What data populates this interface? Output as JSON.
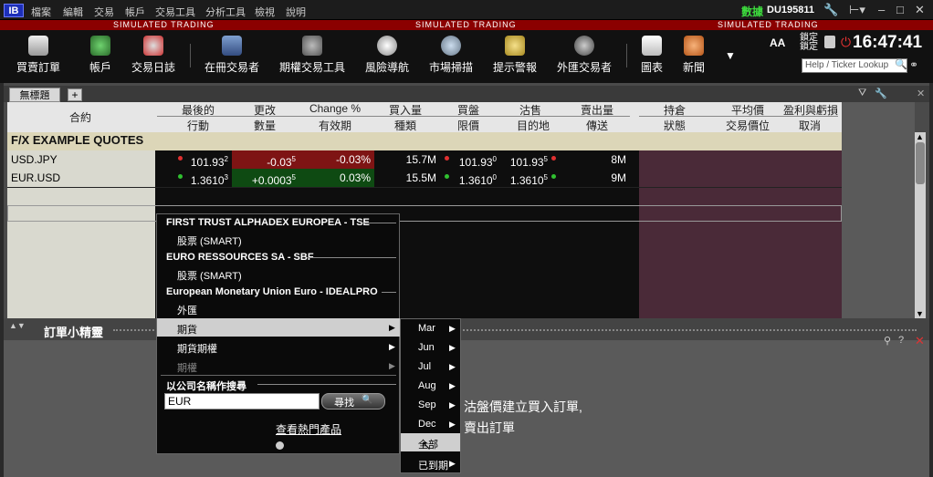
{
  "menubar": {
    "logo": "IB",
    "items": [
      "檔案",
      "編輯",
      "交易",
      "帳戶",
      "交易工具",
      "分析工具",
      "檢視",
      "說明"
    ],
    "data_label": "數據",
    "account_id": "DU195811"
  },
  "sim_text": "SIMULATED TRADING",
  "toolbar": {
    "buttons": [
      "買賣訂單",
      "帳戶",
      "交易日誌",
      "在冊交易者",
      "期權交易工具",
      "風險導航",
      "市場掃描",
      "提示警報",
      "外匯交易者",
      "圖表",
      "新聞"
    ],
    "font_toggle": "AA",
    "lock_label": "鎖定\n鎖定",
    "clock": "16:47:41",
    "search_placeholder": "Help / Ticker Lookup"
  },
  "tabs": {
    "current": "無標題",
    "add": "+"
  },
  "columns": {
    "contract": "合約",
    "top": [
      "最後的",
      "更改",
      "Change %",
      "買入量",
      "買盤",
      "沽售",
      "賣出量",
      "持倉",
      "平均價",
      "盈利與虧損"
    ],
    "bottom": [
      "行動",
      "數量",
      "有效期",
      "種類",
      "限價",
      "目的地",
      "傳送",
      "狀態",
      "交易價位",
      "取消"
    ]
  },
  "group_header": "F/X EXAMPLE QUOTES",
  "rows": [
    {
      "symbol": "USD.JPY",
      "last": "101.93",
      "last_sup": "2",
      "change": "-0.03",
      "change_sup": "5",
      "change_pct": "-0.03%",
      "bid_size": "15.7M",
      "bid": "101.93",
      "bid_sup": "0",
      "ask": "101.93",
      "ask_sup": "5",
      "ask_size": "8M",
      "dir": "down"
    },
    {
      "symbol": "EUR.USD",
      "last": "1.3610",
      "last_sup": "3",
      "change": "+0.0003",
      "change_sup": "5",
      "change_pct": "0.03%",
      "bid_size": "15.5M",
      "bid": "1.3610",
      "bid_sup": "0",
      "ask": "1.3610",
      "ask_sup": "5",
      "ask_size": "9M",
      "dir": "up"
    }
  ],
  "colors": {
    "neg": "#7e1414",
    "pos": "#0e4a12",
    "red_dot": "#e03030",
    "green_dot": "#30c030",
    "pink": "#4a2a38"
  },
  "wizard": {
    "title": "訂單小精靈",
    "text1": "沽盤價建立買入訂單,",
    "text2": "賣出訂單"
  },
  "popup": {
    "sections": [
      {
        "title": "FIRST TRUST ALPHADEX EUROPEA - TSE",
        "items": [
          "股票 (SMART)"
        ]
      },
      {
        "title": "EURO RESSOURCES SA - SBF",
        "items": [
          "股票 (SMART)"
        ]
      },
      {
        "title": "European Monetary Union Euro - IDEALPRO",
        "items": [
          "外匯",
          "期貨",
          "期貨期權",
          "期權"
        ]
      }
    ],
    "company_search_title": "以公司名稱作搜尋",
    "search_value": "EUR",
    "search_button": "尋找",
    "hot_link": "查看熱門產品"
  },
  "submenu": {
    "items": [
      "Mar",
      "Jun",
      "Jul",
      "Aug",
      "Sep",
      "Dec",
      "全部",
      "已到期"
    ]
  }
}
